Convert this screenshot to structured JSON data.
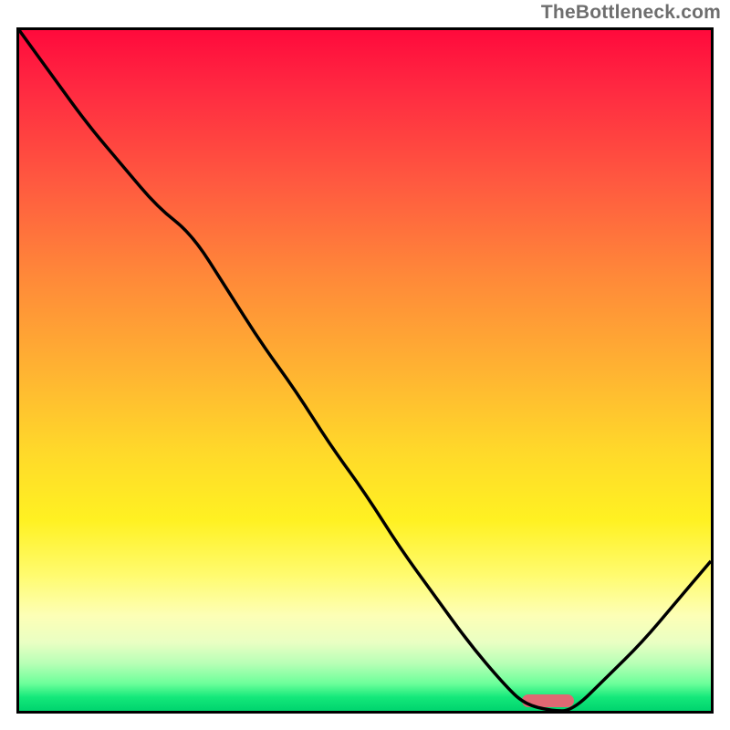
{
  "watermark": "TheBottleneck.com",
  "chart_data": {
    "type": "line",
    "title": "",
    "xlabel": "",
    "ylabel": "",
    "xlim": [
      0,
      100
    ],
    "ylim": [
      0,
      100
    ],
    "x": [
      0,
      5,
      10,
      15,
      20,
      25,
      30,
      35,
      40,
      45,
      50,
      55,
      60,
      65,
      70,
      73,
      77,
      80,
      85,
      90,
      95,
      100
    ],
    "values": [
      100,
      93,
      86,
      80,
      74,
      70,
      62,
      54,
      47,
      39,
      32,
      24,
      17,
      10,
      4,
      1,
      0,
      0,
      5,
      10,
      16,
      22
    ],
    "marker": {
      "x_start": 73,
      "x_end": 80,
      "y": 0
    },
    "background": "red-yellow-green vertical gradient",
    "grid": false,
    "legend": false
  }
}
